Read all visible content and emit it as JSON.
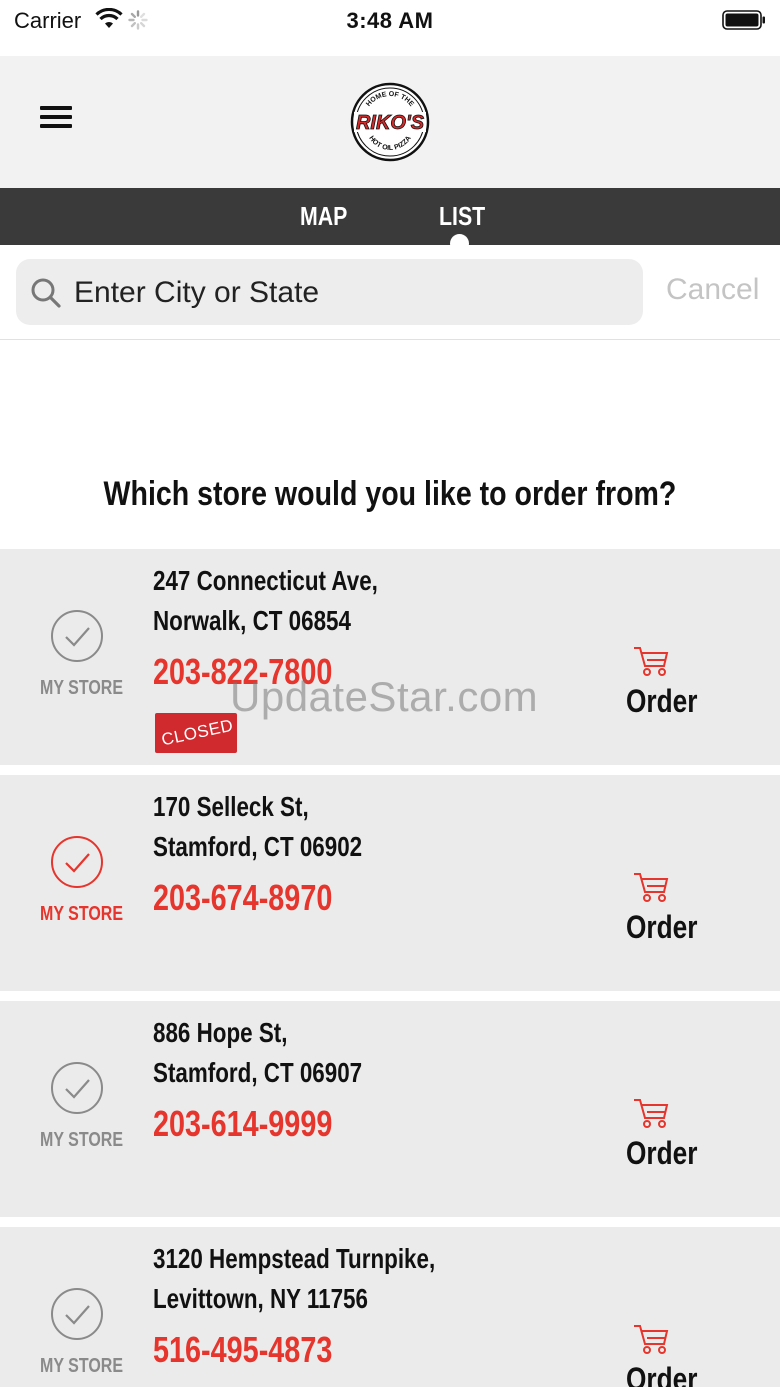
{
  "status_bar": {
    "carrier": "Carrier",
    "time": "3:48 AM"
  },
  "header": {
    "logo": {
      "name": "RIKO'S",
      "tagline_top": "HOME OF THE",
      "tagline_bottom": "HOT OIL PIZZA"
    }
  },
  "tabs": [
    {
      "label": "MAP",
      "selected": false
    },
    {
      "label": "LIST",
      "selected": true
    }
  ],
  "search": {
    "placeholder": "Enter City or State",
    "value": "",
    "cancel_label": "Cancel"
  },
  "prompt": "Which store would you like to order from?",
  "stores": [
    {
      "address_line1": "247 Connecticut Ave,",
      "address_line2": "Norwalk, CT 06854",
      "phone": "203-822-7800",
      "my_store_label": "MY STORE",
      "is_my_store": false,
      "badge": "CLOSED",
      "order_label": "Order"
    },
    {
      "address_line1": "170 Selleck St,",
      "address_line2": "Stamford, CT 06902",
      "phone": "203-674-8970",
      "my_store_label": "MY STORE",
      "is_my_store": true,
      "order_label": "Order"
    },
    {
      "address_line1": "886 Hope St,",
      "address_line2": "Stamford, CT 06907",
      "phone": "203-614-9999",
      "my_store_label": "MY STORE",
      "is_my_store": false,
      "order_label": "Order"
    },
    {
      "address_line1": "3120 Hempstead Turnpike,",
      "address_line2": "Levittown, NY 11756",
      "phone": "516-495-4873",
      "my_store_label": "MY STORE",
      "is_my_store": false,
      "order_label": "Order"
    }
  ],
  "watermark": "UpdateStar.com",
  "colors": {
    "accent": "#e5352c",
    "tab_bar": "#3a3a3a",
    "card_bg": "#ebebeb",
    "header_bg": "#f2f2f2",
    "closed_badge": "#d02a2f"
  }
}
